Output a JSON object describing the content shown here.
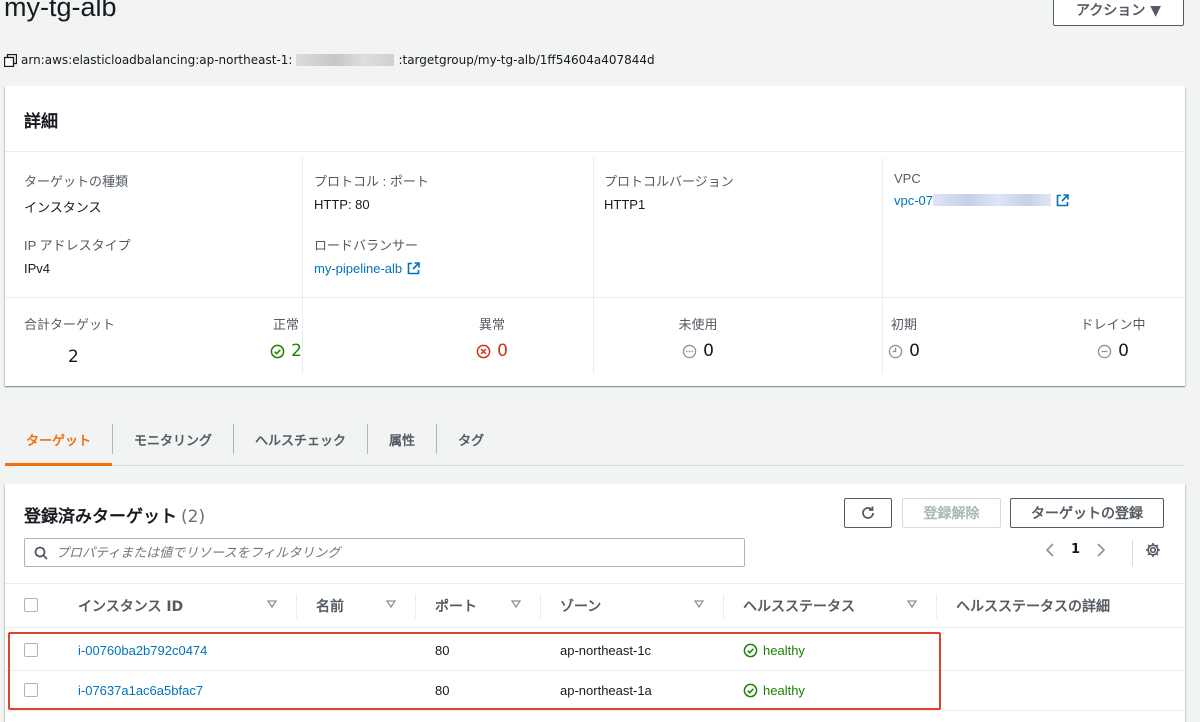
{
  "header": {
    "title": "my-tg-alb",
    "actions_label": "アクション ▼"
  },
  "arn": {
    "prefix": "arn:aws:elasticloadbalancing:ap-northeast-1:",
    "suffix": ":targetgroup/my-tg-alb/1ff54604a407844d"
  },
  "details": {
    "heading": "詳細",
    "target_type": {
      "label": "ターゲットの種類",
      "value": "インスタンス"
    },
    "ip_type": {
      "label": "IP アドレスタイプ",
      "value": "IPv4"
    },
    "protocol_port": {
      "label": "プロトコル : ポート",
      "value": "HTTP: 80"
    },
    "load_balancer": {
      "label": "ロードバランサー",
      "value": "my-pipeline-alb"
    },
    "protocol_version": {
      "label": "プロトコルバージョン",
      "value": "HTTP1"
    },
    "vpc": {
      "label": "VPC",
      "value": "vpc-07"
    },
    "counts": [
      {
        "label": "合計ターゲット",
        "value": "2"
      },
      {
        "label": "正常",
        "value": "2"
      },
      {
        "label": "異常",
        "value": "0"
      },
      {
        "label": "未使用",
        "value": "0"
      },
      {
        "label": "初期",
        "value": "0"
      },
      {
        "label": "ドレイン中",
        "value": "0"
      }
    ]
  },
  "tabs": [
    "ターゲット",
    "モニタリング",
    "ヘルスチェック",
    "属性",
    "タグ"
  ],
  "targets": {
    "title": "登録済みターゲット",
    "count": "(2)",
    "deregister_label": "登録解除",
    "register_label": "ターゲットの登録",
    "filter_placeholder": "プロパティまたは値でリソースをフィルタリング",
    "page": "1",
    "columns": [
      "インスタンス ID",
      "名前",
      "ポート",
      "ゾーン",
      "ヘルスステータス",
      "ヘルスステータスの詳細"
    ],
    "rows": [
      {
        "id": "i-00760ba2b792c0474",
        "name": "",
        "port": "80",
        "zone": "ap-northeast-1c",
        "health": "healthy",
        "detail": ""
      },
      {
        "id": "i-07637a1ac6a5bfac7",
        "name": "",
        "port": "80",
        "zone": "ap-northeast-1a",
        "health": "healthy",
        "detail": ""
      }
    ]
  },
  "colors": {
    "link": "#0073bb",
    "accent": "#ec7211",
    "healthy": "#1d8102",
    "unhealthy": "#d13212",
    "highlight": "#e0422b"
  }
}
